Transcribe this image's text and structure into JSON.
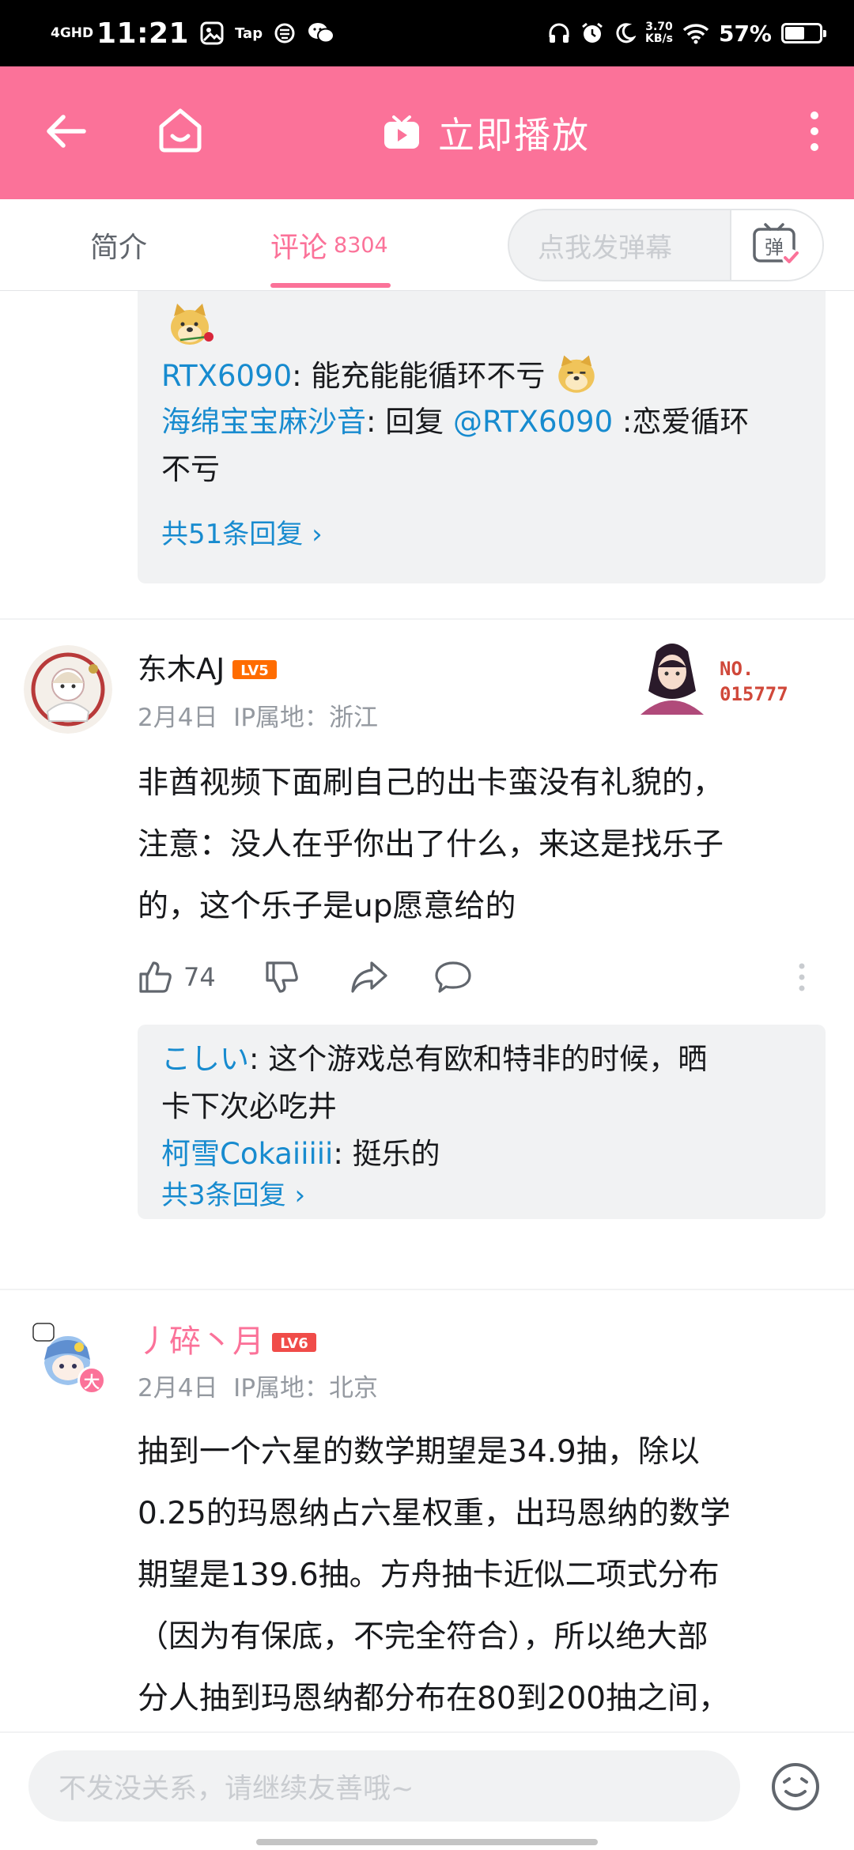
{
  "status_bar": {
    "network": "4GHD",
    "time": "11:21",
    "tap_label": "Tap",
    "speed_value": "3.70",
    "speed_unit": "KB/s",
    "battery_text": "57%",
    "battery_level": 0.57
  },
  "header": {
    "play_now_label": "立即播放",
    "accent_color": "#fb7299"
  },
  "tabs": {
    "intro_label": "简介",
    "comments_label": "评论",
    "comments_count": "8304",
    "danmaku_placeholder": "点我发弹幕",
    "danmaku_switch_glyph": "弹"
  },
  "top_thread": {
    "replies": [
      {
        "user": "RTX6090",
        "sep": ": ",
        "text": "能充能能循环不亏"
      },
      {
        "user": "海绵宝宝麻沙音",
        "sep": ": ",
        "text": "回复 ",
        "mention": "@RTX6090",
        "text2": " :恋爱循环",
        "text3": "不亏"
      }
    ],
    "more_replies": "共51条回复 ›"
  },
  "comments": [
    {
      "user": "东木AJ",
      "level": "LV5",
      "date": "2月4日",
      "location": "IP属地：浙江",
      "badge_no_label": "NO.",
      "badge_no_value": "015777",
      "lines": [
        "非酋视频下面刷自己的出卡蛮没有礼貌的，",
        "注意：没人在乎你出了什么，来这是找乐子",
        "的，这个乐子是up愿意给的"
      ],
      "likes": "74",
      "replies": [
        {
          "user": "こしい",
          "sep": ": ",
          "text": "这个游戏总有欧和特非的时候，晒",
          "text2": "卡下次必吃井"
        },
        {
          "user": "柯雪Cokaiiiii",
          "sep": ": ",
          "text": "挺乐的"
        }
      ],
      "more_replies": "共3条回复 ›"
    },
    {
      "user": "丿碎丶月",
      "level": "LV6",
      "date": "2月4日",
      "location": "IP属地：北京",
      "avatar_badge": "大",
      "lines": [
        "抽到一个六星的数学期望是34.9抽，除以",
        "0.25的玛恩纳占六星权重，出玛恩纳的数学",
        "期望是139.6抽。方舟抽卡近似二项式分布",
        "（因为有保底，不完全符合），所以绝大部",
        "分人抽到玛恩纳都分布在80到200抽之间，"
      ]
    }
  ],
  "bottom": {
    "input_placeholder": "不发没关系，请继续友善哦~"
  }
}
